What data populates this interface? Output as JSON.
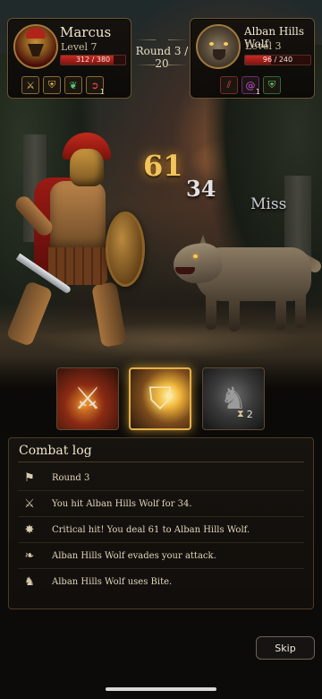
{
  "player": {
    "name": "Marcus",
    "level": "Level 7",
    "hp_text": "312 / 380",
    "hp_fraction": 0.82,
    "buffs": [
      {
        "icon": "sword-icon",
        "glyph": "⚔",
        "count": ""
      },
      {
        "icon": "shield-icon",
        "glyph": "⛨",
        "count": ""
      },
      {
        "icon": "wing-icon",
        "glyph": "❦",
        "count": ""
      },
      {
        "icon": "spiral-icon",
        "glyph": "➲",
        "count": "1"
      }
    ]
  },
  "enemy": {
    "name": "Alban Hills Wolf",
    "level": "Level 3",
    "hp_text": "96 / 240",
    "hp_fraction": 0.4,
    "debuffs": [
      {
        "icon": "claw-icon",
        "glyph": "⫽",
        "count": ""
      },
      {
        "icon": "vortex-icon",
        "glyph": "@",
        "count": "1"
      },
      {
        "icon": "guard-icon",
        "glyph": "⛨",
        "count": ""
      }
    ]
  },
  "round": "Round 3 / 20",
  "floating": {
    "crit": "61",
    "hit": "34",
    "miss": "Miss"
  },
  "actions": [
    {
      "name": "attack",
      "icon": "sword-slash-icon",
      "glyph": "⚔",
      "selected": false
    },
    {
      "name": "shield-bash",
      "icon": "shield-burst-icon",
      "glyph": "⛉",
      "selected": true
    },
    {
      "name": "wolf-summon",
      "icon": "wolf-head-icon",
      "glyph": "♞",
      "selected": false,
      "cooldown": "2"
    }
  ],
  "log": {
    "title": "Combat log",
    "entries": [
      {
        "icon": "flag-icon",
        "glyph": "⚑",
        "text": "Round 3"
      },
      {
        "icon": "crossed-swords-icon",
        "glyph": "⚔",
        "text": "You hit Alban Hills Wolf for 34."
      },
      {
        "icon": "burst-icon",
        "glyph": "✸",
        "text": "Critical hit! You deal 61 to Alban Hills Wolf."
      },
      {
        "icon": "wing-icon",
        "glyph": "❧",
        "text": "Alban Hills Wolf evades your attack."
      },
      {
        "icon": "wolf-icon",
        "glyph": "♞",
        "text": "Alban Hills Wolf uses Bite."
      }
    ]
  },
  "skip_label": "Skip"
}
